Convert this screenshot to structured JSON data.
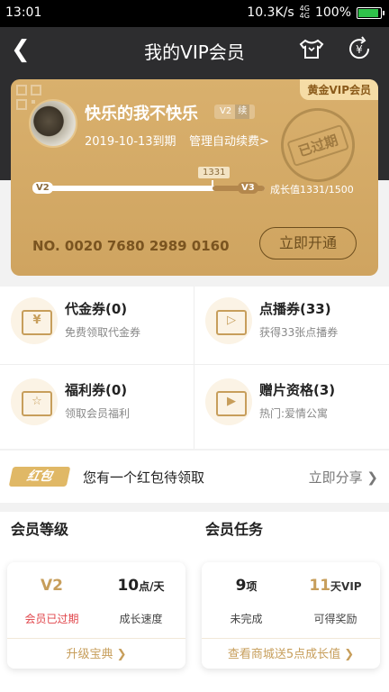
{
  "status": {
    "time": "13:01",
    "speed": "10.3K/s",
    "net1": "4G",
    "net2": "4G",
    "battery": "100%"
  },
  "header": {
    "title": "我的VIP会员"
  },
  "card": {
    "tag": "黄金VIP会员",
    "username": "快乐的我不快乐",
    "level_badge": "V2",
    "level_continue": "续",
    "expire": "2019-10-13到期",
    "manage": "管理自动续费>",
    "stamp": "已过期",
    "level_from": "V2",
    "level_to": "V3",
    "growth_marker": "1331",
    "growth_text": "成长值1331/1500",
    "progress": 0.887,
    "card_no": "NO. 0020 7680 2989 0160",
    "open_btn": "立即开通"
  },
  "benefits": [
    {
      "title": "代金券(0)",
      "sub": "免费领取代金券",
      "icon": "yen-ticket-icon"
    },
    {
      "title": "点播券(33)",
      "sub": "获得33张点播券",
      "icon": "play-ticket-icon"
    },
    {
      "title": "福利券(0)",
      "sub": "领取会员福利",
      "icon": "star-ticket-icon"
    },
    {
      "title": "赠片资格(3)",
      "sub": "热门:爱情公寓",
      "icon": "gift-play-icon"
    }
  ],
  "redpack": {
    "label": "红包",
    "text": "您有一个红包待领取",
    "share": "立即分享"
  },
  "level_section": {
    "title": "会员等级",
    "left_big": "V2",
    "left_small": "会员已过期",
    "right_big": "10",
    "right_unit": "点/天",
    "right_small": "成长速度",
    "link": "升级宝典"
  },
  "task_section": {
    "title": "会员任务",
    "left_big": "9",
    "left_unit": "项",
    "left_small": "未完成",
    "right_big": "11",
    "right_unit": "天VIP",
    "right_small": "可得奖励",
    "link": "查看商城送5点成长值"
  },
  "colors": {
    "gold": "#d4a964",
    "accent": "#c79e5b",
    "expired": "#e0444a",
    "header_bg": "#2d2d2f"
  }
}
